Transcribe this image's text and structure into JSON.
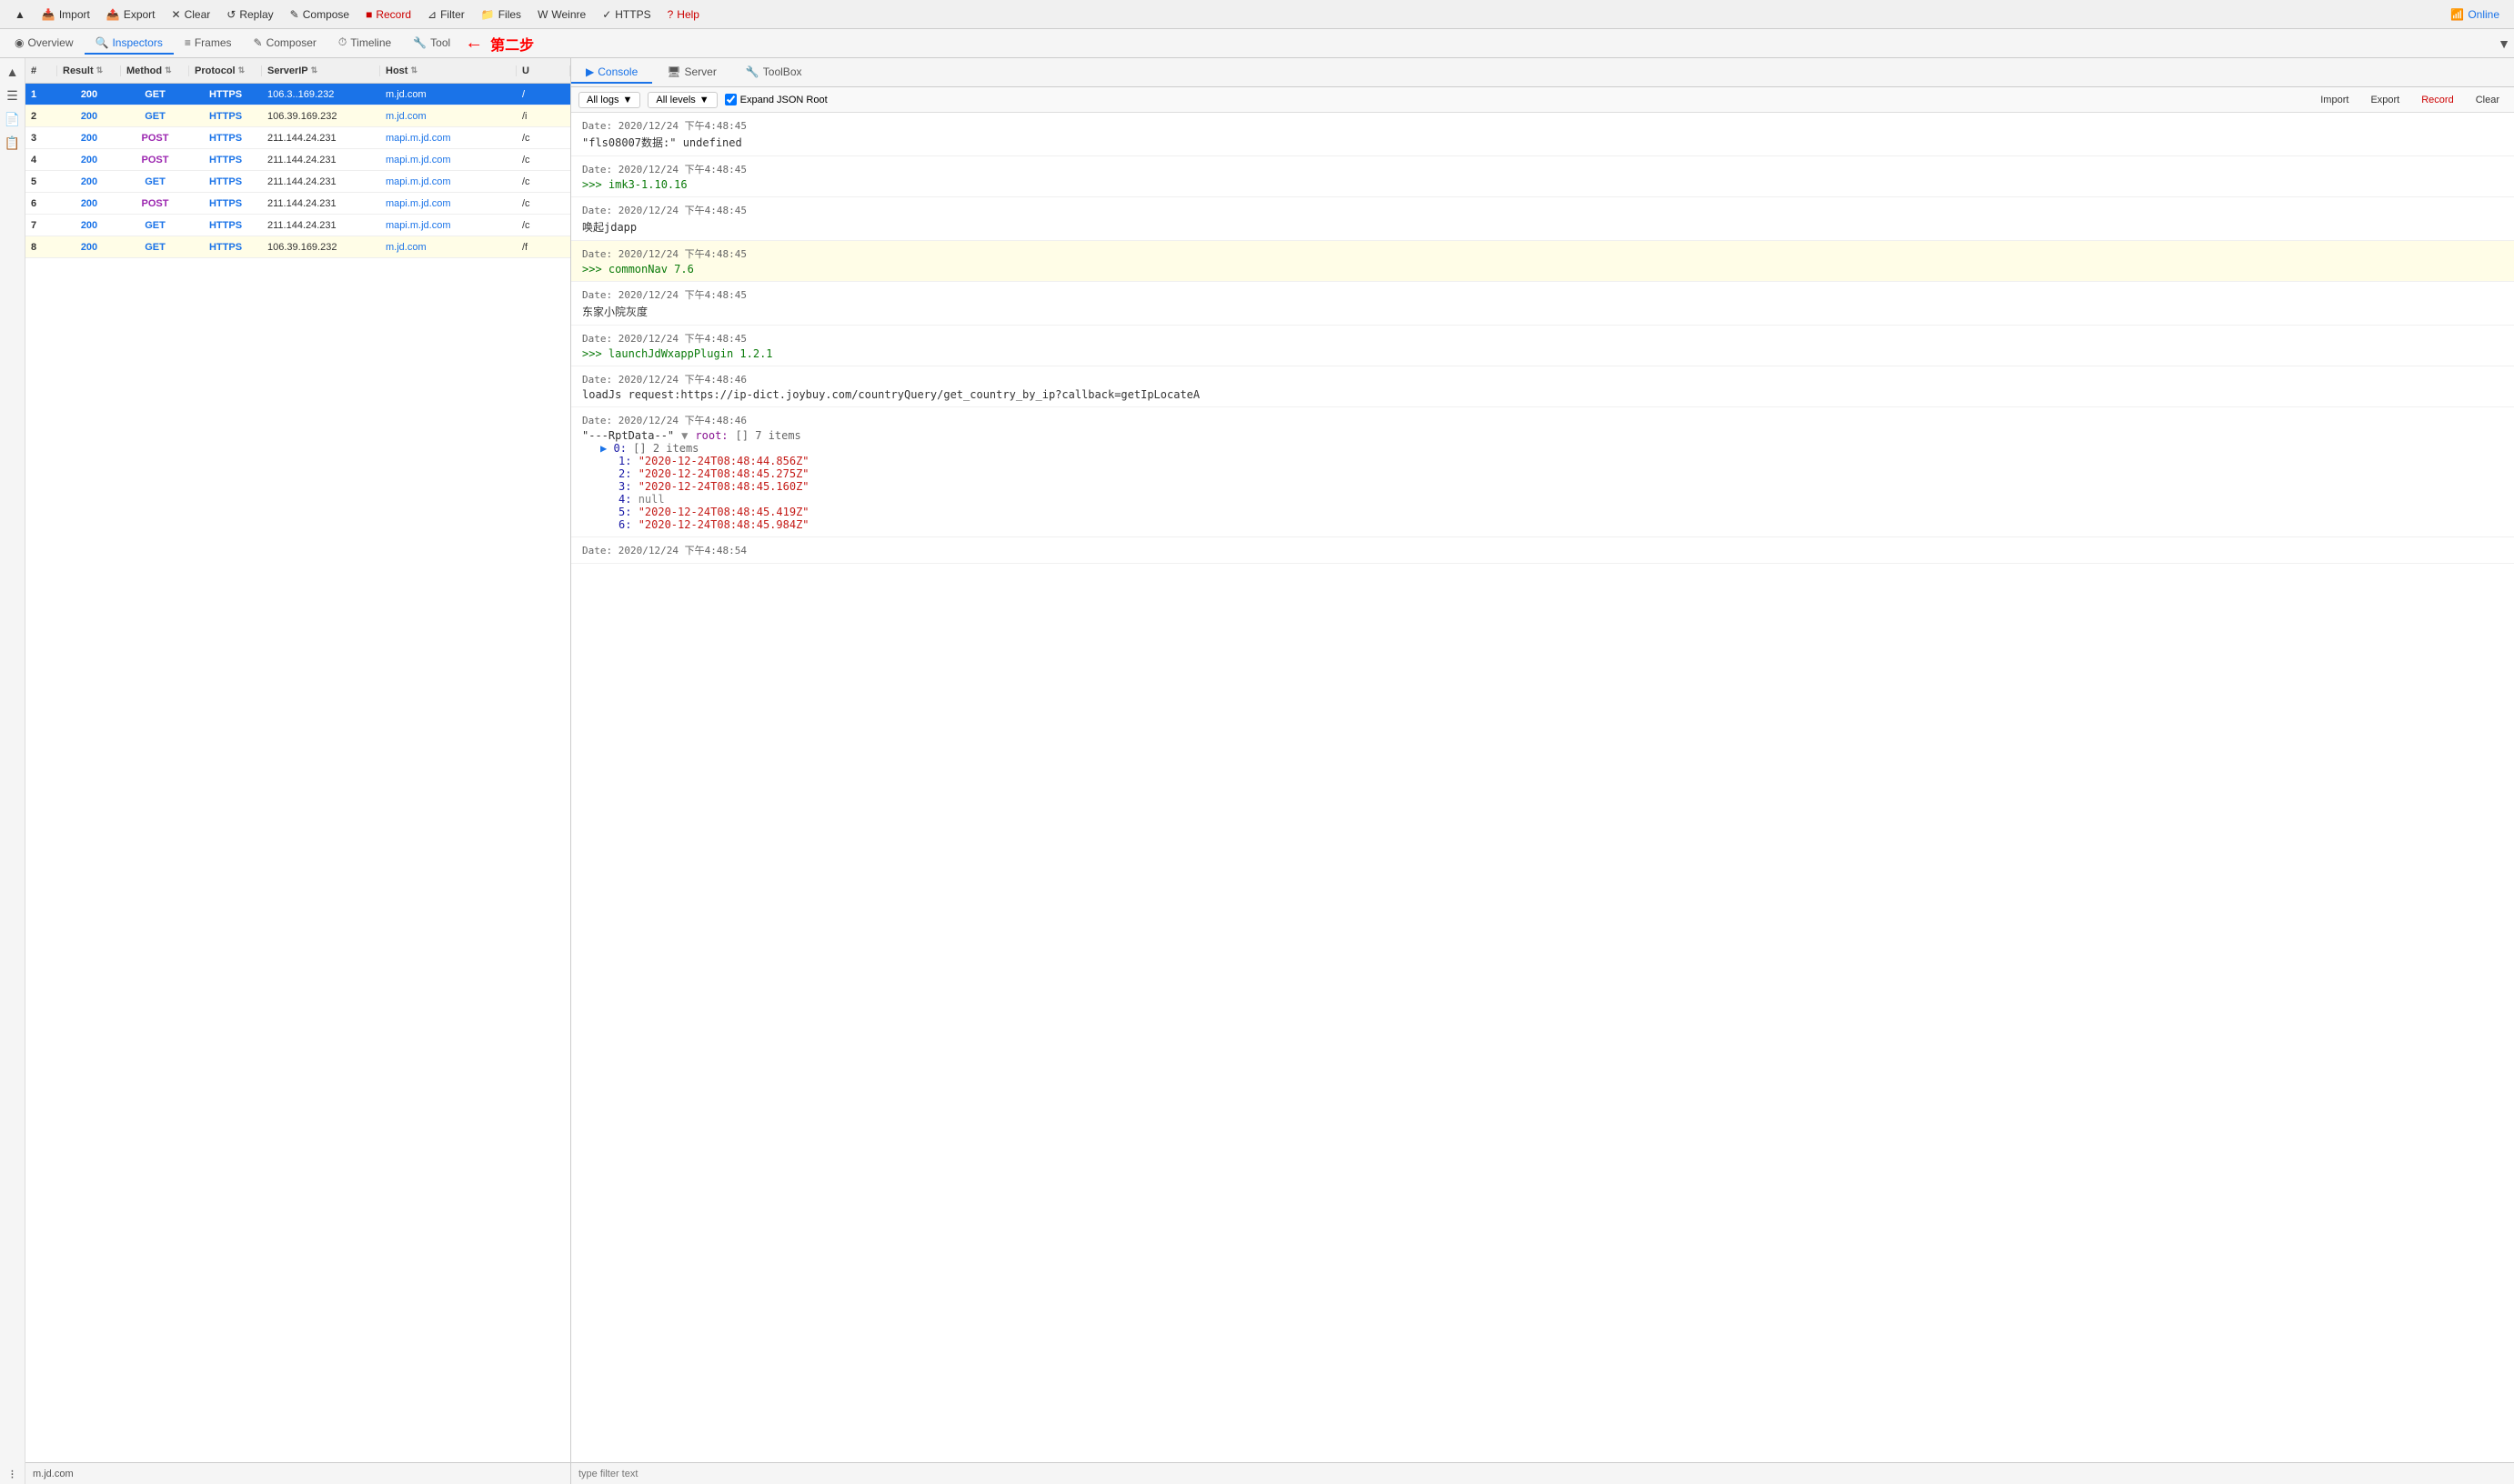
{
  "toolbar": {
    "buttons": [
      {
        "id": "up",
        "label": "▲",
        "icon": "▲"
      },
      {
        "id": "import",
        "label": "Import",
        "icon": "📥"
      },
      {
        "id": "export",
        "label": "Export",
        "icon": "📤"
      },
      {
        "id": "clear",
        "label": "Clear",
        "icon": "✕"
      },
      {
        "id": "replay",
        "label": "Replay",
        "icon": "↺"
      },
      {
        "id": "compose",
        "label": "Compose",
        "icon": "✎"
      },
      {
        "id": "record",
        "label": "Record",
        "icon": "■"
      },
      {
        "id": "filter",
        "label": "Filter",
        "icon": "⊿"
      },
      {
        "id": "files",
        "label": "Files",
        "icon": "📁"
      },
      {
        "id": "weinre",
        "label": "Weinre",
        "icon": "W"
      },
      {
        "id": "https",
        "label": "HTTPS",
        "icon": "✓"
      },
      {
        "id": "help",
        "label": "Help",
        "icon": "?"
      },
      {
        "id": "online",
        "label": "Online",
        "icon": "📶"
      }
    ]
  },
  "nav_tabs": [
    {
      "id": "overview",
      "label": "Overview",
      "icon": "◉",
      "active": false
    },
    {
      "id": "inspectors",
      "label": "Inspectors",
      "icon": "🔍",
      "active": true
    },
    {
      "id": "frames",
      "label": "Frames",
      "icon": "≡",
      "active": false
    },
    {
      "id": "composer",
      "label": "Composer",
      "icon": "✎",
      "active": false
    },
    {
      "id": "timeline",
      "label": "Timeline",
      "icon": "⏱",
      "active": false
    },
    {
      "id": "tool",
      "label": "Tool",
      "icon": "🔧",
      "active": false
    }
  ],
  "step_label": "第二步",
  "table": {
    "headers": [
      "#",
      "Result",
      "Method",
      "Protocol",
      "ServerIP",
      "Host",
      "U"
    ],
    "rows": [
      {
        "num": "1",
        "result": "200",
        "method": "GET",
        "protocol": "HTTPS",
        "serverip": "106.3..169.232",
        "host": "m.jd.com",
        "url": "/",
        "selected": true
      },
      {
        "num": "2",
        "result": "200",
        "method": "GET",
        "protocol": "HTTPS",
        "serverip": "106.39.169.232",
        "host": "m.jd.com",
        "url": "/i",
        "selected": false,
        "highlighted": true
      },
      {
        "num": "3",
        "result": "200",
        "method": "POST",
        "protocol": "HTTPS",
        "serverip": "211.144.24.231",
        "host": "mapi.m.jd.com",
        "url": "/c",
        "selected": false
      },
      {
        "num": "4",
        "result": "200",
        "method": "POST",
        "protocol": "HTTPS",
        "serverip": "211.144.24.231",
        "host": "mapi.m.jd.com",
        "url": "/c",
        "selected": false
      },
      {
        "num": "5",
        "result": "200",
        "method": "GET",
        "protocol": "HTTPS",
        "serverip": "211.144.24.231",
        "host": "mapi.m.jd.com",
        "url": "/c",
        "selected": false
      },
      {
        "num": "6",
        "result": "200",
        "method": "POST",
        "protocol": "HTTPS",
        "serverip": "211.144.24.231",
        "host": "mapi.m.jd.com",
        "url": "/c",
        "selected": false
      },
      {
        "num": "7",
        "result": "200",
        "method": "GET",
        "protocol": "HTTPS",
        "serverip": "211.144.24.231",
        "host": "mapi.m.jd.com",
        "url": "/c",
        "selected": false
      },
      {
        "num": "8",
        "result": "200",
        "method": "GET",
        "protocol": "HTTPS",
        "serverip": "106.39.169.232",
        "host": "m.jd.com",
        "url": "/f",
        "selected": false,
        "highlighted": true
      }
    ]
  },
  "status_bar": {
    "text": "m.jd.com"
  },
  "inspector_tabs": [
    {
      "id": "console",
      "label": "Console",
      "icon": "▶",
      "active": true
    },
    {
      "id": "server",
      "label": "Server",
      "icon": "🖥",
      "active": false
    },
    {
      "id": "toolbox",
      "label": "ToolBox",
      "icon": "🔧",
      "active": false
    }
  ],
  "console_filter": {
    "log_level": "All logs",
    "level_filter": "All levels",
    "expand_json_root": true,
    "expand_label": "Expand JSON Root"
  },
  "console_actions": {
    "import": "Import",
    "export": "Export",
    "record": "Record",
    "clear": "Clear"
  },
  "log_entries": [
    {
      "id": 1,
      "date": "Date: 2020/12/24 下午4:48:45",
      "content": "\"fls08007数据:\"  undefined",
      "alt": false
    },
    {
      "id": 2,
      "date": "Date: 2020/12/24 下午4:48:45",
      "content": ">>> imk3-1.10.16",
      "alt": false,
      "green": true
    },
    {
      "id": 3,
      "date": "Date: 2020/12/24 下午4:48:45",
      "content": "唤起jdapp",
      "alt": false
    },
    {
      "id": 4,
      "date": "Date: 2020/12/24 下午4:48:45",
      "content": ">>> commonNav 7.6",
      "alt": true,
      "green": true
    },
    {
      "id": 5,
      "date": "Date: 2020/12/24 下午4:48:45",
      "content": "东家小院灰度",
      "alt": false
    },
    {
      "id": 6,
      "date": "Date: 2020/12/24 下午4:48:45",
      "content": ">>> launchJdWxappPlugin  1.2.1",
      "alt": false,
      "green": true
    },
    {
      "id": 7,
      "date": "Date: 2020/12/24 下午4:48:46",
      "content": "loadJs request:https://ip-dict.joybuy.com/countryQuery/get_country_by_ip?callback=getIpLocateA",
      "alt": false
    },
    {
      "id": 8,
      "date": "Date: 2020/12/24 下午4:48:46",
      "content": "---RptData--",
      "alt": false,
      "is_json": true
    }
  ],
  "json_tree": {
    "root_label": "root:",
    "root_meta": "[]  7 items",
    "item0": {
      "label": "0:",
      "meta": "[]  2 items",
      "expanded": true
    },
    "items": [
      {
        "key": "1:",
        "value": "\"2020-12-24T08:48:44.856Z\""
      },
      {
        "key": "2:",
        "value": "\"2020-12-24T08:48:45.275Z\""
      },
      {
        "key": "3:",
        "value": "\"2020-12-24T08:48:45.160Z\""
      },
      {
        "key": "4:",
        "value": "null"
      },
      {
        "key": "5:",
        "value": "\"2020-12-24T08:48:45.419Z\""
      },
      {
        "key": "6:",
        "value": "\"2020-12-24T08:48:45.984Z\""
      }
    ]
  },
  "filter_placeholder": "type filter text",
  "last_date": "Date: 2020/12/24 下午4:48:54"
}
